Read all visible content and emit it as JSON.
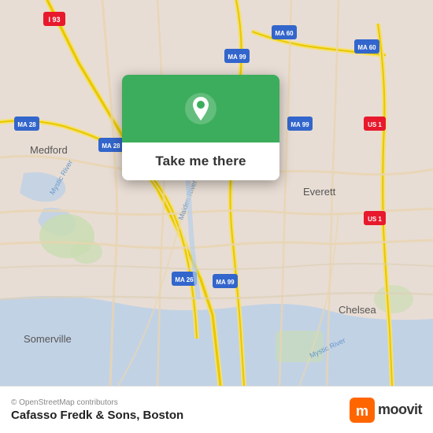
{
  "map": {
    "alt": "Map of Boston area showing Medford, Everett, Somerville, Chelsea"
  },
  "popup": {
    "button_label": "Take me there",
    "pin_icon": "location-pin"
  },
  "footer": {
    "copyright": "© OpenStreetMap contributors",
    "place_name": "Cafasso Fredk & Sons, Boston",
    "brand": "moovit"
  },
  "colors": {
    "green": "#3cad5c",
    "white": "#ffffff",
    "text_dark": "#333333",
    "text_gray": "#888888"
  }
}
